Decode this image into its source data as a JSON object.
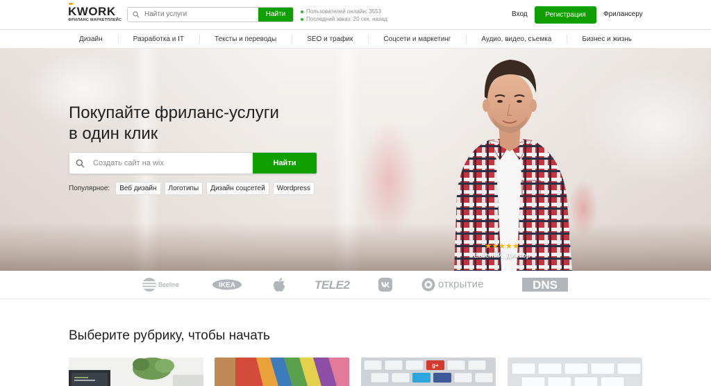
{
  "header": {
    "logo_word": "KWORK",
    "logo_sub": "ФРИЛАНС МАРКЕТПЛЕЙС",
    "search_placeholder": "Найти услуги",
    "search_button": "Найти",
    "stats": [
      "Пользователей онлайн: 3553",
      "Последний заказ: 20 сек. назад"
    ],
    "login": "Вход",
    "register": "Регистрация",
    "freelancer": "Фрилансеру"
  },
  "categories": [
    "Дизайн",
    "Разработка и IT",
    "Тексты и переводы",
    "SEO и трафик",
    "Соцсети и маркетинг",
    "Аудио, видео, съемка",
    "Бизнес и жизнь"
  ],
  "hero": {
    "title_line1": "Покупайте фриланс-услуги",
    "title_line2": "в один клик",
    "search_placeholder": "Создать сайт на wix",
    "search_button": "Найти",
    "popular_label": "Популярное:",
    "popular_tags": [
      "Веб дизайн",
      "Логотипы",
      "Дизайн соцсетей",
      "Wordpress"
    ],
    "stars": "★★★★★",
    "rating": 5,
    "person_name": "Евгений, Диктор"
  },
  "brands": [
    "Beeline",
    "IKEA",
    "apple",
    "TELE2",
    "VK",
    "ОТКРЫТИЕ",
    "DNS"
  ],
  "rubric_title": "Выберите рубрику, чтобы начать",
  "colors": {
    "accent_green": "#0fa000",
    "logo_orange": "#ff9d1b",
    "star_yellow": "#ffb400",
    "brand_gray": "#aeb3b8"
  }
}
